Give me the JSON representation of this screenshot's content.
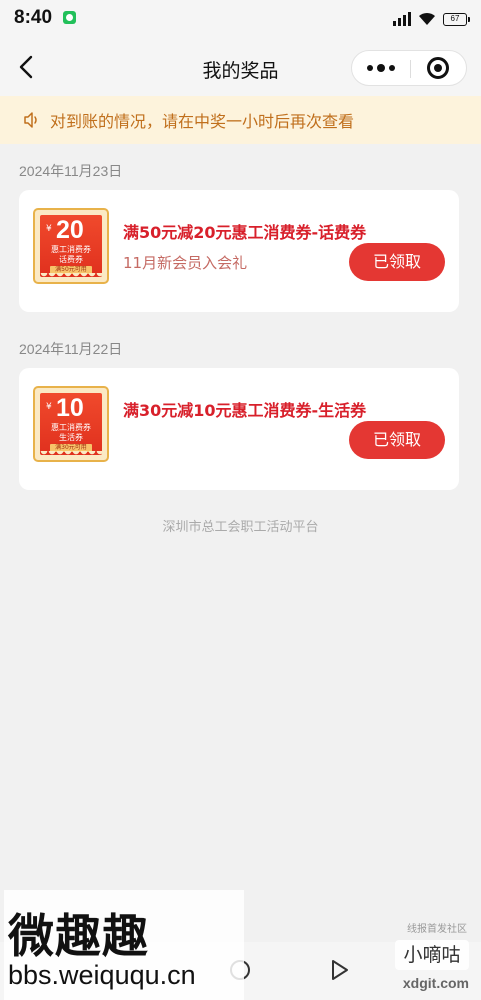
{
  "status_bar": {
    "time": "8:40",
    "battery": "67"
  },
  "nav": {
    "title": "我的奖品"
  },
  "notice": {
    "text": "对到账的情况，请在中奖一小时后再次查看"
  },
  "prizes": [
    {
      "date": "2024年11月23日",
      "coupon": {
        "yen": "¥",
        "amount": "20",
        "name": "惠工消费券",
        "type": "话费券",
        "condition": "满50元可用"
      },
      "title": "满50元减20元惠工消费券-话费券",
      "subtitle": "11月新会员入会礼",
      "button": "已领取"
    },
    {
      "date": "2024年11月22日",
      "coupon": {
        "yen": "¥",
        "amount": "10",
        "name": "惠工消费券",
        "type": "生活券",
        "condition": "满30元可用"
      },
      "title": "满30元减10元惠工消费券-生活券",
      "subtitle": "",
      "button": "已领取"
    }
  ],
  "footer": {
    "text": "深圳市总工会职工活动平台"
  },
  "watermarks": {
    "site_name": "微趣趣",
    "site_url": "bbs.weiququ.cn",
    "right_small": "线报首发社区",
    "right_badge": "小嘀咕",
    "right_url": "xdgit.com"
  },
  "colors": {
    "accent_red": "#e43733",
    "title_red": "#d8202b",
    "notice_bg": "#fdf3dc",
    "notice_text": "#c06f1c"
  }
}
